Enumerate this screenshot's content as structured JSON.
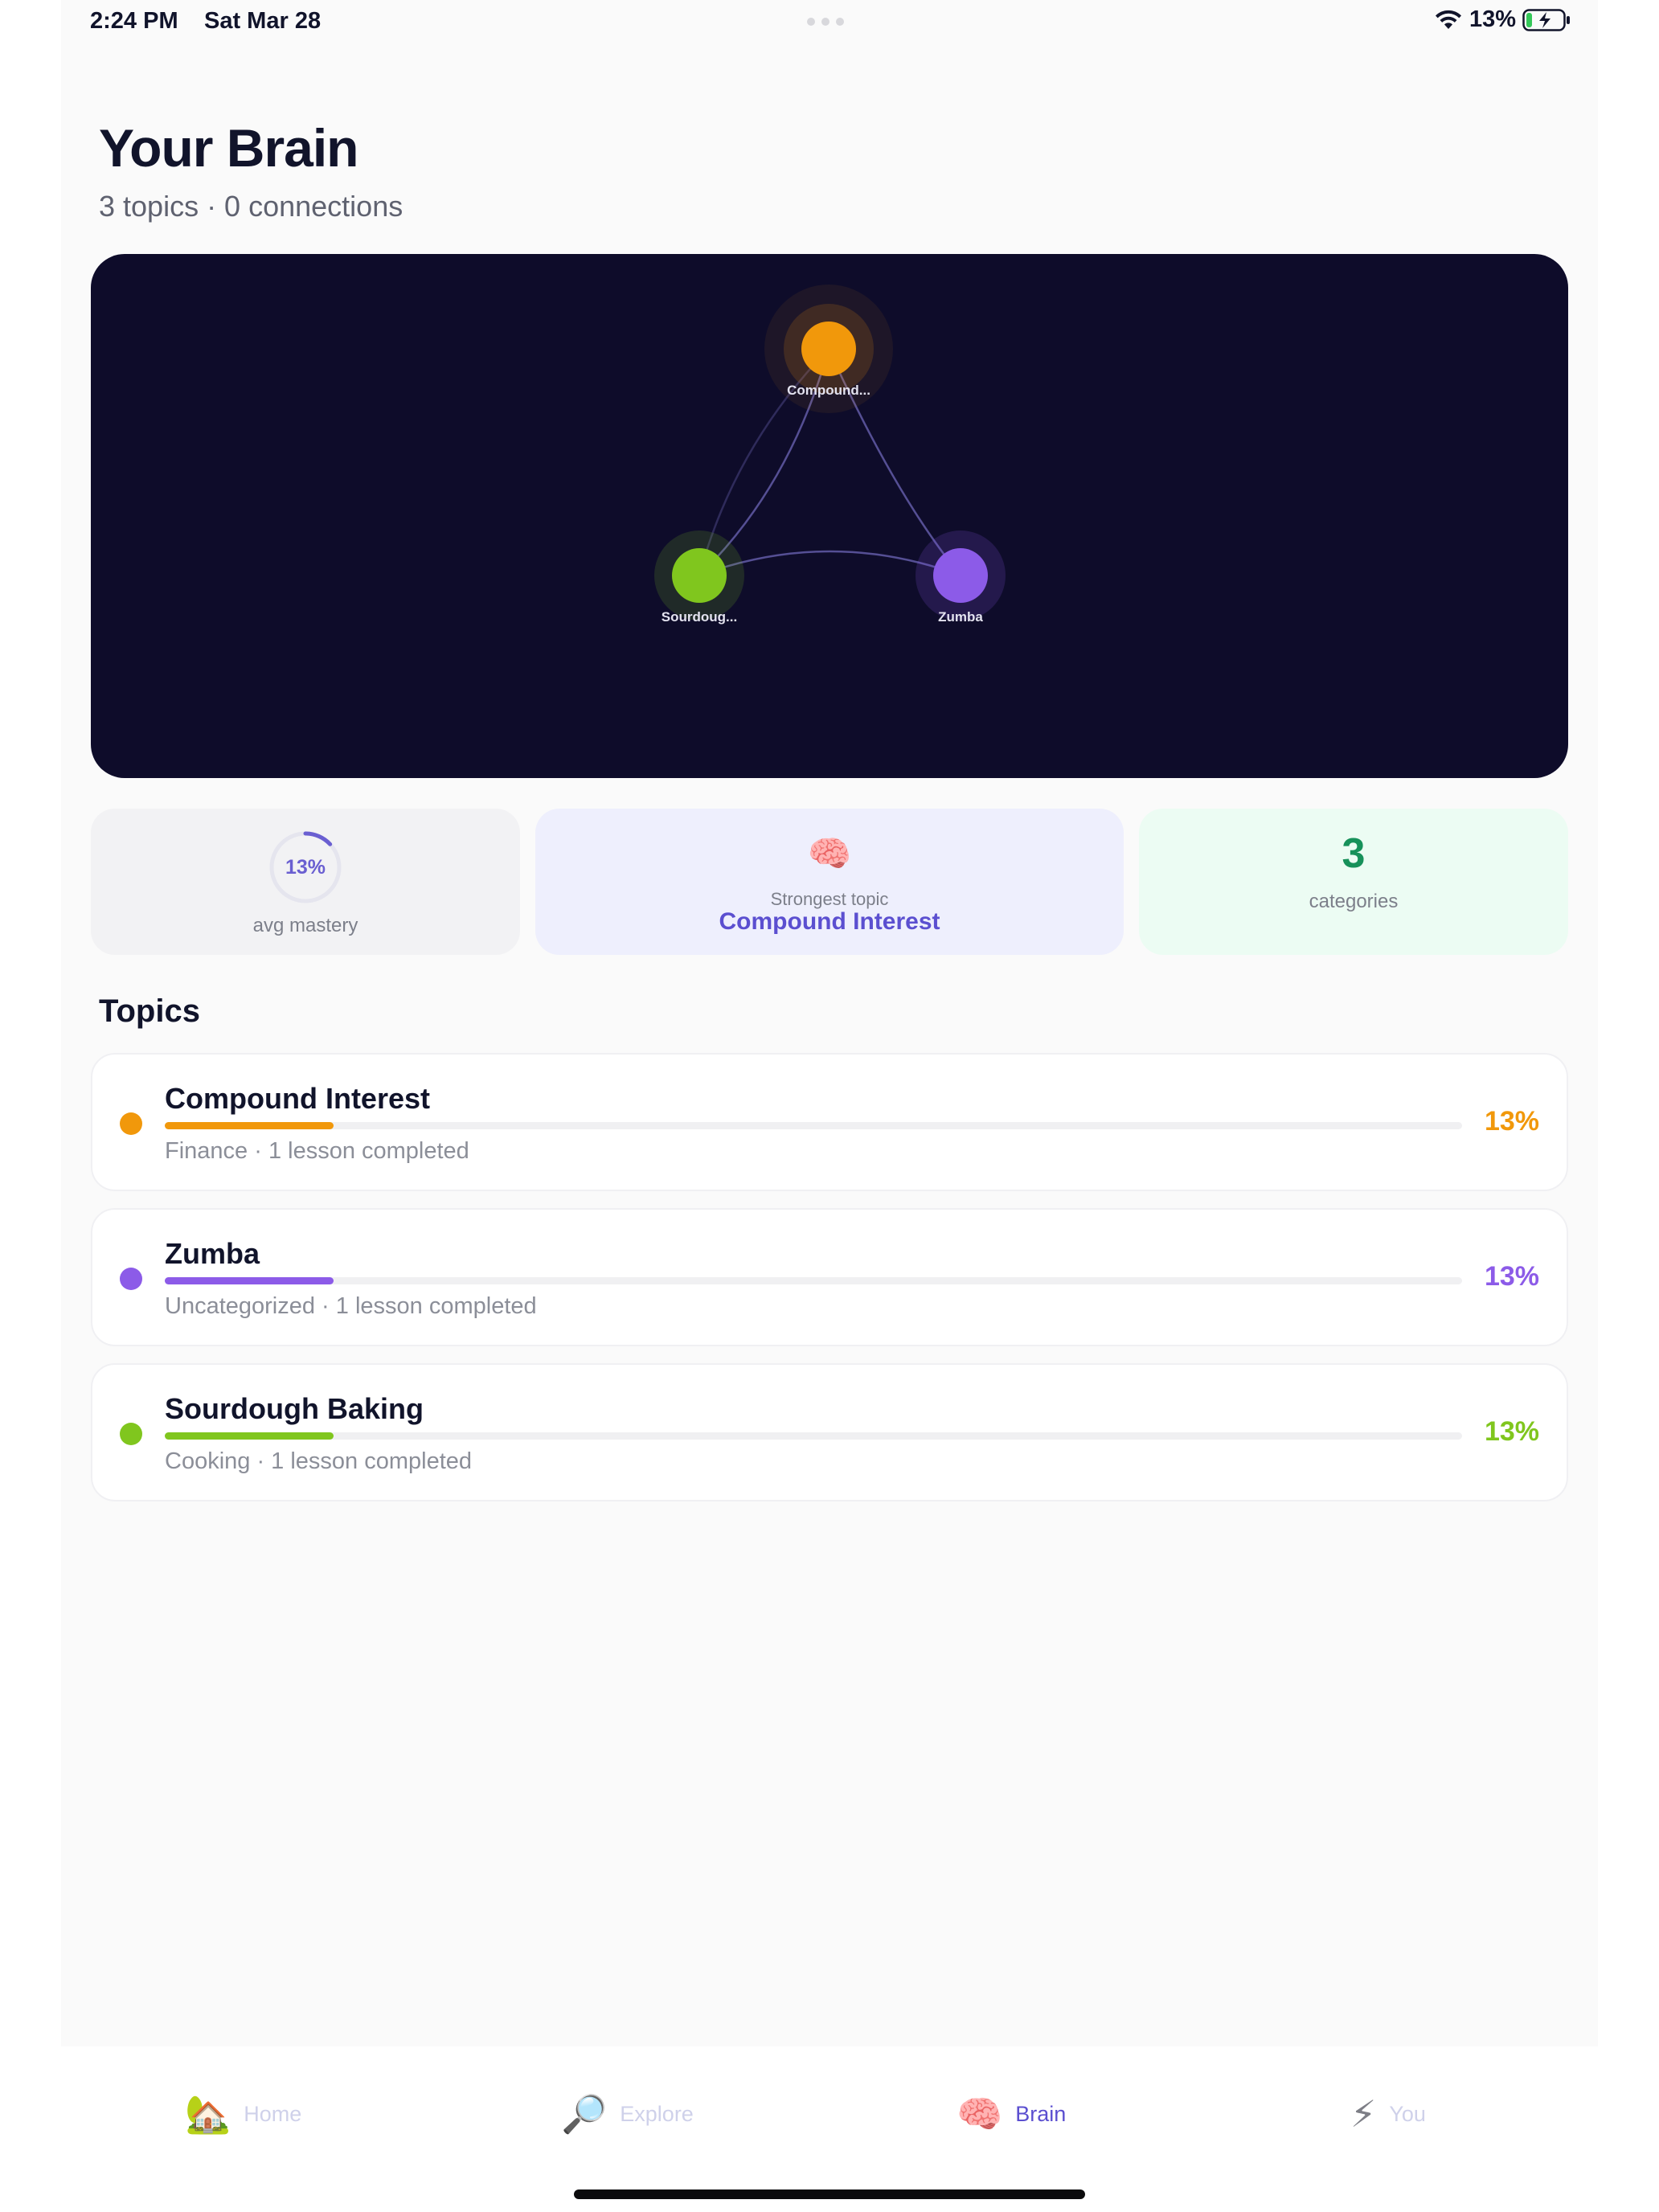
{
  "status_bar": {
    "time": "2:24 PM",
    "date": "Sat Mar 28",
    "battery_pct": "13%",
    "icons": [
      "wifi-icon",
      "battery-charging-icon"
    ]
  },
  "header": {
    "title": "Your Brain",
    "subtitle": "3 topics · 0 connections"
  },
  "graph": {
    "nodes": [
      {
        "label": "Compound...",
        "color": "#f1980b"
      },
      {
        "label": "Sourdoug...",
        "color": "#80c61e"
      },
      {
        "label": "Zumba",
        "color": "#8c5be8"
      }
    ]
  },
  "stats": {
    "mastery": {
      "value": "13%",
      "label": "avg mastery",
      "fraction": 0.13
    },
    "strongest": {
      "icon": "brain-icon",
      "label": "Strongest topic",
      "value": "Compound Interest"
    },
    "categories": {
      "count": "3",
      "label": "categories"
    }
  },
  "topics_section": {
    "title": "Topics",
    "items": [
      {
        "name": "Compound Interest",
        "meta": "Finance · 1 lesson completed",
        "pct": "13%",
        "progress": 0.13,
        "color": "#f1980b"
      },
      {
        "name": "Zumba",
        "meta": "Uncategorized · 1 lesson completed",
        "pct": "13%",
        "progress": 0.13,
        "color": "#8c5be8"
      },
      {
        "name": "Sourdough Baking",
        "meta": "Cooking · 1 lesson completed",
        "pct": "13%",
        "progress": 0.13,
        "color": "#80c61e"
      }
    ]
  },
  "tab_bar": {
    "tabs": [
      {
        "label": "Home",
        "icon": "house-tree-icon",
        "glyph": "🏡",
        "active": false
      },
      {
        "label": "Explore",
        "icon": "magnifier-icon",
        "glyph": "🔎",
        "active": false
      },
      {
        "label": "Brain",
        "icon": "brain-icon",
        "glyph": "🧠",
        "active": true
      },
      {
        "label": "You",
        "icon": "lightning-icon",
        "glyph": "⚡",
        "active": false
      }
    ]
  },
  "colors": {
    "accent": "#5b4fd0",
    "graph_bg": "#0e0c2a",
    "categories_green": "#17915a"
  }
}
